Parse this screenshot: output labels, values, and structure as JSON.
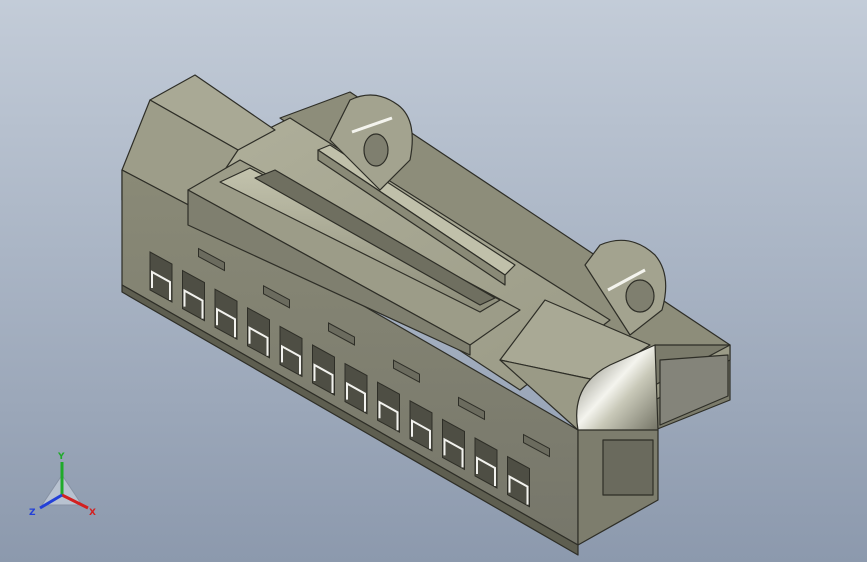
{
  "viewport": {
    "background_top": "#c3ccd8",
    "background_bottom": "#8c99ad"
  },
  "model": {
    "body_color": "#8f8f7c",
    "top_color": "#a6a691",
    "shadow_color": "#5e5e50",
    "edge_color": "#2e2e27",
    "highlight_color": "#f2f2ee"
  },
  "triad": {
    "x_label": "X",
    "y_label": "Y",
    "z_label": "Z",
    "x_color": "#d32020",
    "y_color": "#1faa2a",
    "z_color": "#2340d8"
  }
}
